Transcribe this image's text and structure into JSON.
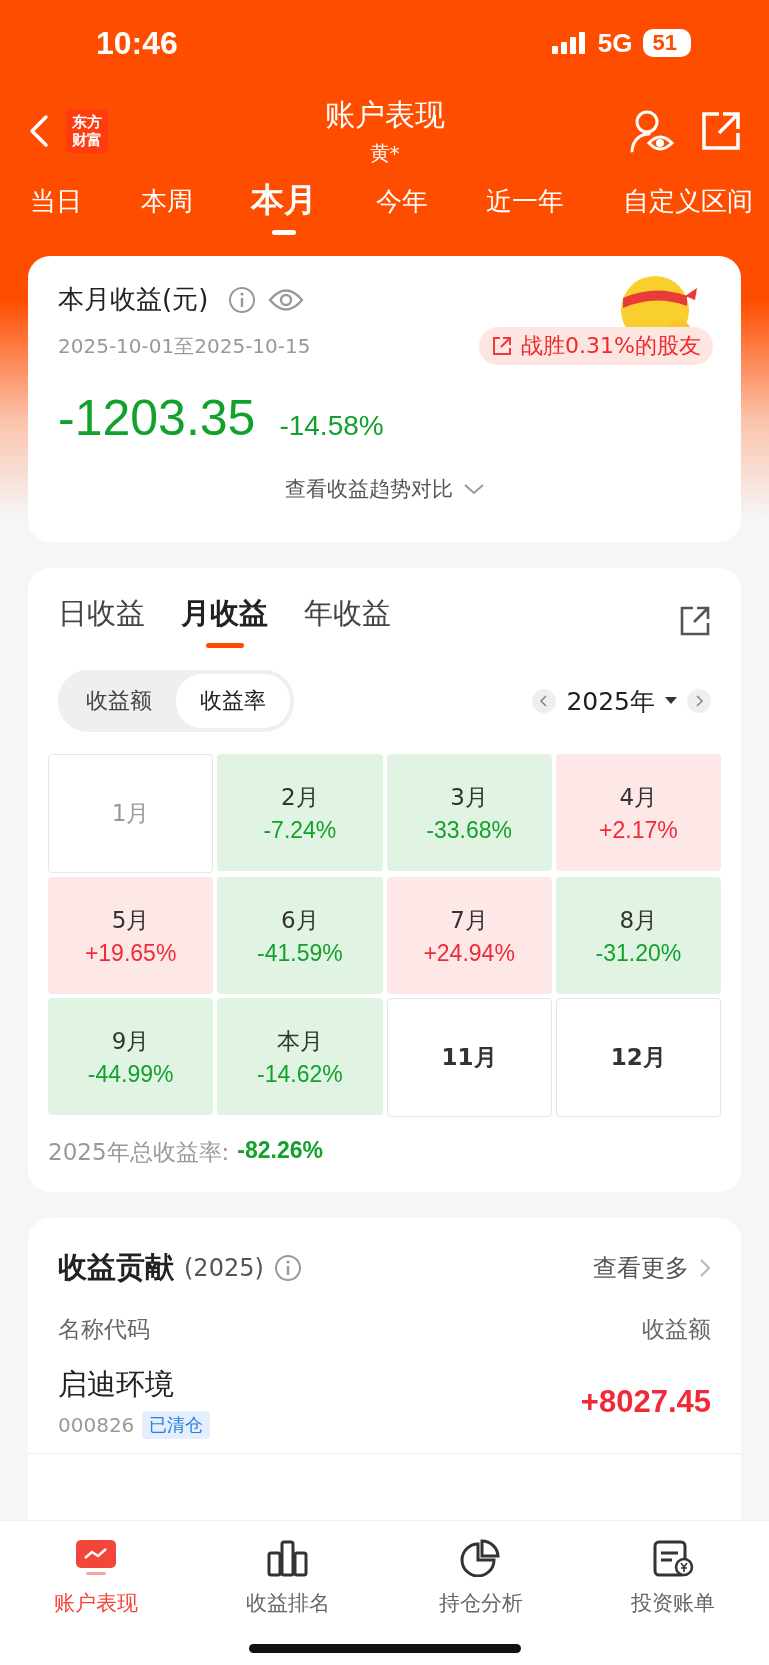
{
  "status_bar": {
    "time": "10:46",
    "network": "5G",
    "battery": "51"
  },
  "header": {
    "logo": [
      "东方",
      "财富"
    ],
    "title": "账户表现",
    "subtitle": "黄*"
  },
  "period_tabs": [
    {
      "label": "当日",
      "selected": false
    },
    {
      "label": "本周",
      "selected": false
    },
    {
      "label": "本月",
      "selected": true
    },
    {
      "label": "今年",
      "selected": false
    },
    {
      "label": "近一年",
      "selected": false
    },
    {
      "label": "自定义区间",
      "selected": false
    }
  ],
  "summary": {
    "title": "本月收益(元)",
    "date_range": "2025-10-01至2025-10-15",
    "badge": "战胜0.31%的股友",
    "amount": "-1203.35",
    "percent": "-14.58%",
    "kind": "loss",
    "compare_link": "查看收益趋势对比"
  },
  "profit_tabs": [
    {
      "label": "日收益",
      "selected": false
    },
    {
      "label": "月收益",
      "selected": true
    },
    {
      "label": "年收益",
      "selected": false
    }
  ],
  "mode_toggle": [
    {
      "label": "收益额",
      "selected": false
    },
    {
      "label": "收益率",
      "selected": true
    }
  ],
  "year_picker": "2025年",
  "months": [
    {
      "label": "1月",
      "kind": "empty"
    },
    {
      "label": "2月",
      "value": "-7.24%",
      "kind": "loss"
    },
    {
      "label": "3月",
      "value": "-33.68%",
      "kind": "loss"
    },
    {
      "label": "4月",
      "value": "+2.17%",
      "kind": "gain"
    },
    {
      "label": "5月",
      "value": "+19.65%",
      "kind": "gain"
    },
    {
      "label": "6月",
      "value": "-41.59%",
      "kind": "loss"
    },
    {
      "label": "7月",
      "value": "+24.94%",
      "kind": "gain"
    },
    {
      "label": "8月",
      "value": "-31.20%",
      "kind": "loss"
    },
    {
      "label": "9月",
      "value": "-44.99%",
      "kind": "loss"
    },
    {
      "label": "本月",
      "value": "-14.62%",
      "kind": "loss"
    },
    {
      "label": "11月",
      "kind": "empty"
    },
    {
      "label": "12月",
      "kind": "empty"
    }
  ],
  "year_total": {
    "label": "2025年总收益率:",
    "value": "-82.26%",
    "kind": "loss"
  },
  "contribution": {
    "title": "收益贡献",
    "year": "(2025)",
    "more": "查看更多",
    "col_name": "名称代码",
    "col_amount": "收益额",
    "rows": [
      {
        "name": "启迪环境",
        "code": "000826",
        "tag": "已清仓",
        "amount": "+8027.45",
        "kind": "gain"
      }
    ]
  },
  "bottom_nav": [
    {
      "label": "账户表现",
      "selected": true
    },
    {
      "label": "收益排名",
      "selected": false
    },
    {
      "label": "持仓分析",
      "selected": false
    },
    {
      "label": "投资账单",
      "selected": false
    }
  ]
}
